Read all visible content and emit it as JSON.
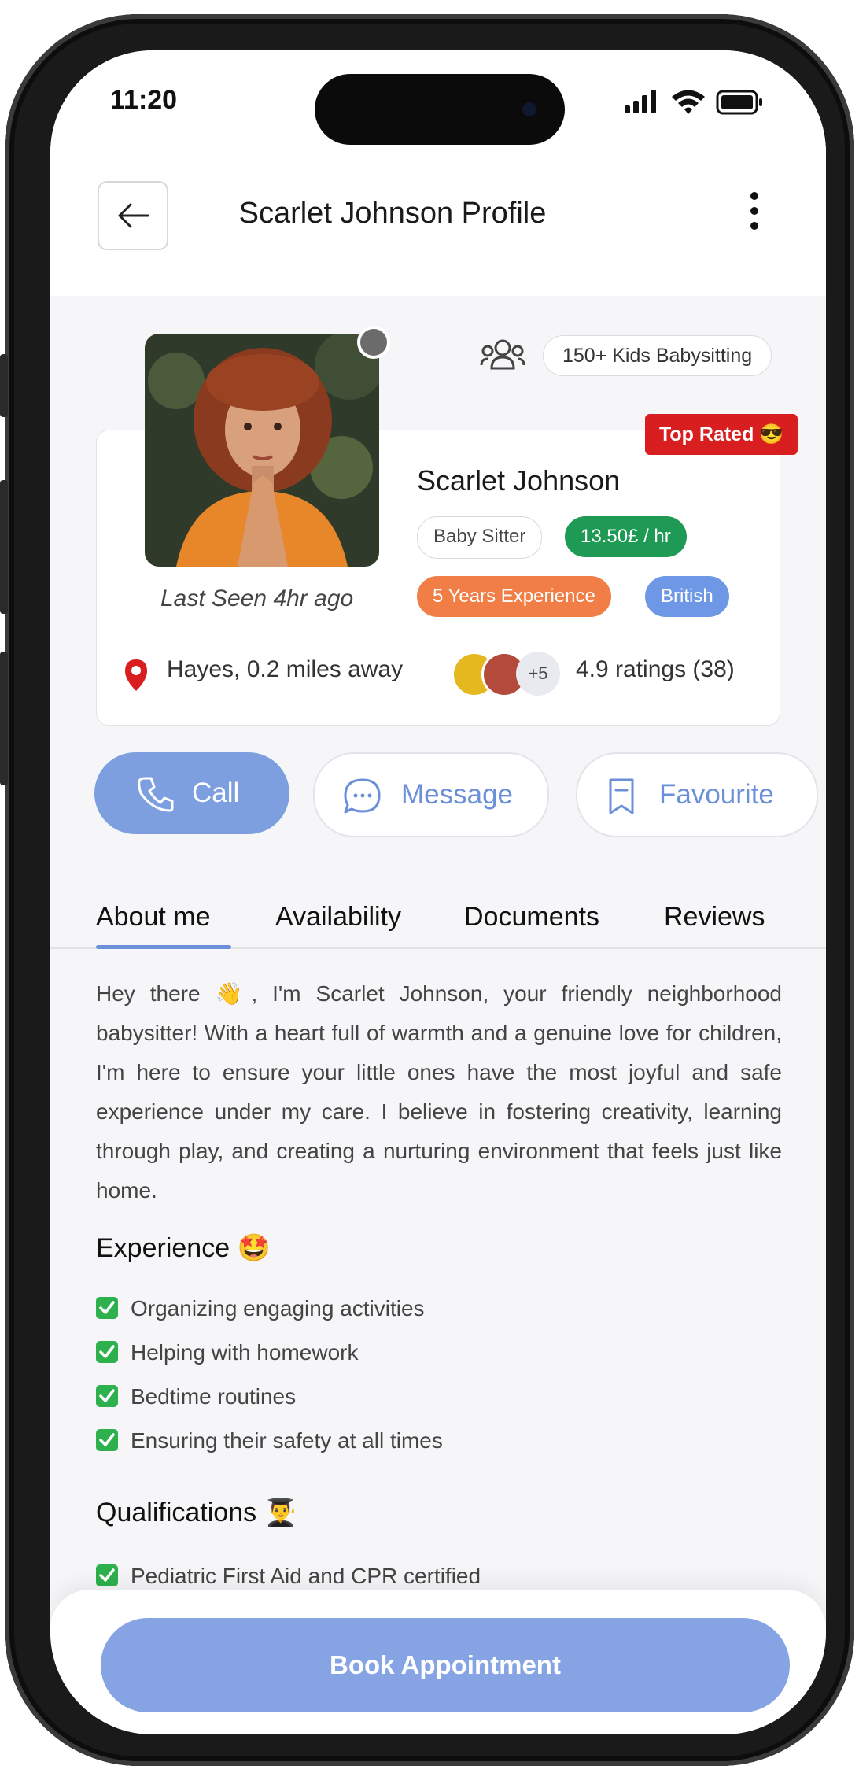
{
  "status_bar": {
    "time": "11:20"
  },
  "header": {
    "title": "Scarlet Johnson Profile"
  },
  "profile": {
    "kids_badge": "150+ Kids Babysitting",
    "top_rated": "Top Rated 😎",
    "name": "Scarlet Johnson",
    "role": "Baby Sitter",
    "rate": "13.50£ / hr",
    "experience": "5 Years Experience",
    "nationality": "British",
    "last_seen": "Last Seen 4hr ago",
    "location": "Hayes, 0.2 miles away",
    "raters_more": "+5",
    "rating": "4.9 ratings (38)"
  },
  "actions": {
    "call": "Call",
    "message": "Message",
    "favourite": "Favourite"
  },
  "tabs": [
    {
      "label": "About me",
      "active": true
    },
    {
      "label": "Availability",
      "active": false
    },
    {
      "label": "Documents",
      "active": false
    },
    {
      "label": "Reviews",
      "active": false
    }
  ],
  "about": {
    "text": "Hey there 👋, I'm Scarlet Johnson, your friendly neighborhood babysitter! With a heart full of warmth and a genuine love for children, I'm here to ensure your little ones have the most joyful and safe experience under my care. I believe in fostering creativity, learning through play, and creating a nurturing environment that feels just like home."
  },
  "experience": {
    "title": "Experience 🤩",
    "items": [
      "Organizing engaging activities",
      "Helping with homework",
      "Bedtime routines",
      "Ensuring their safety at all times"
    ]
  },
  "qualifications": {
    "title": "Qualifications 👨‍🎓",
    "items": [
      "Pediatric First Aid and CPR certified"
    ]
  },
  "book_button": "Book Appointment",
  "colors": {
    "accent": "#7d9fe0",
    "top_rated": "#d81e1e",
    "rate": "#1f9a55",
    "experience": "#f07e46",
    "nationality": "#6e97e6",
    "check": "#2eb04c",
    "location_pin": "#d81e1e"
  }
}
